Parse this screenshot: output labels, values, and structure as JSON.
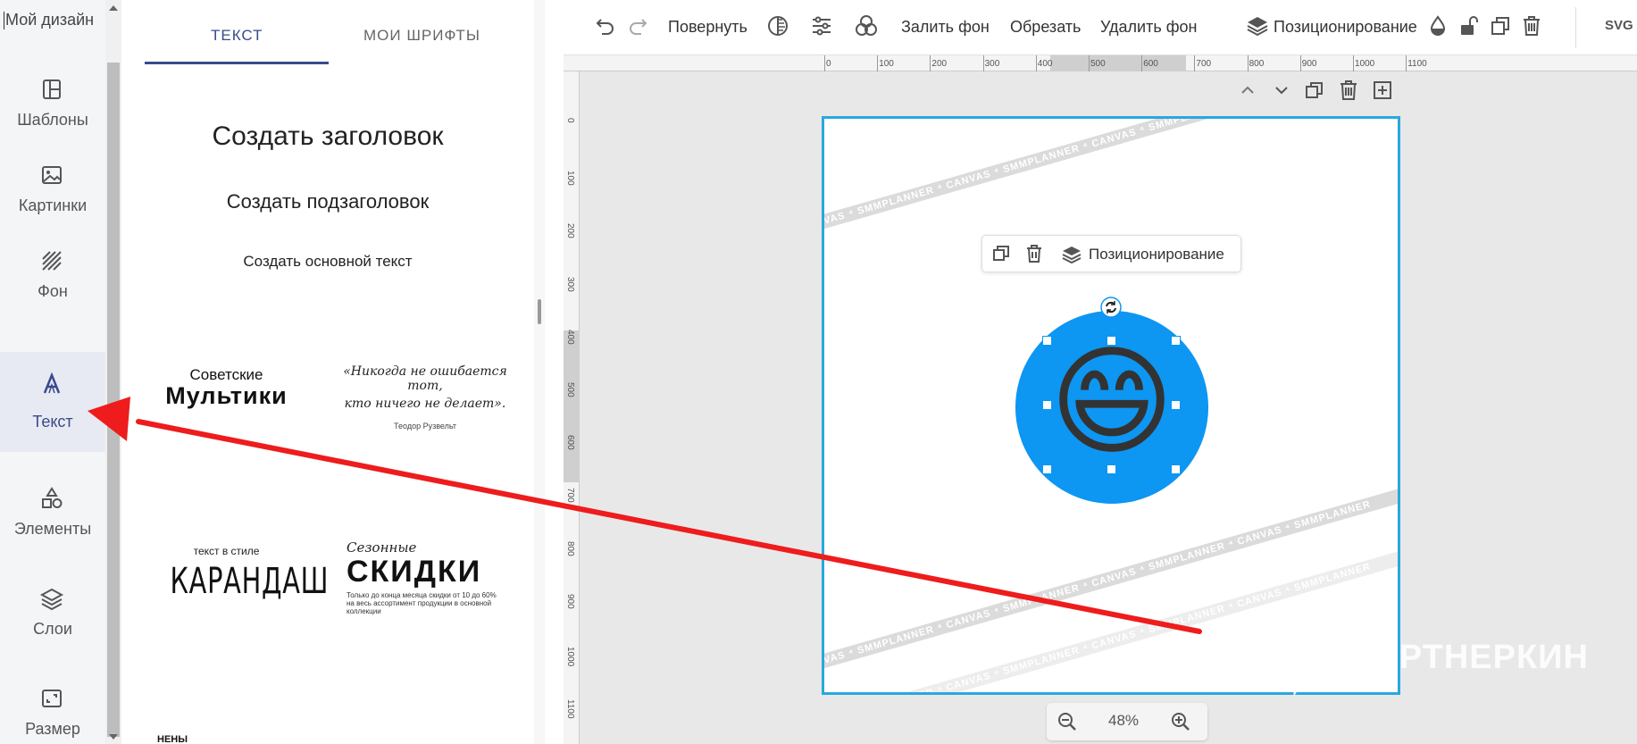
{
  "rail": {
    "title": "Мой дизайн",
    "items": [
      {
        "label": "Шаблоны",
        "icon": "templates-icon"
      },
      {
        "label": "Картинки",
        "icon": "image-icon"
      },
      {
        "label": "Фон",
        "icon": "background-icon"
      },
      {
        "label": "Текст",
        "icon": "text-icon",
        "active": true
      },
      {
        "label": "Элементы",
        "icon": "elements-icon"
      },
      {
        "label": "Слои",
        "icon": "layers-icon"
      },
      {
        "label": "Размер",
        "icon": "resize-icon"
      }
    ]
  },
  "panel": {
    "tabs": [
      {
        "label": "ТЕКСТ",
        "active": true
      },
      {
        "label": "МОИ ШРИФТЫ",
        "active": false
      }
    ],
    "add_heading": "Создать заголовок",
    "add_subheading": "Создать подзаголовок",
    "add_body": "Создать основной текст",
    "templates": [
      {
        "line1": "Советские",
        "line2": "Мультики"
      },
      {
        "line1": "«Никогда не ошибается тот,",
        "line2": "кто ничего не делает».",
        "line3": "Теодор Рузвельт"
      },
      {
        "line1": "текст в стиле",
        "line2": "КАРАНДАШ"
      },
      {
        "line1": "Сезонные",
        "line2": "СКИДКИ",
        "line3": "Только до конца месяца скидки от 10 до 60%",
        "line4": "на весь ассортимент продукции в основной",
        "line5": "коллекции"
      }
    ],
    "more_hint": "НЕНЫ"
  },
  "toolbar": {
    "rotate": "Повернуть",
    "fill_bg": "Залить фон",
    "crop": "Обрезать",
    "remove_bg": "Удалить фон",
    "positioning": "Позиционирование",
    "export": "SVG"
  },
  "ruler": {
    "top": [
      "0",
      "100",
      "200",
      "300",
      "400",
      "500",
      "600",
      "700",
      "800",
      "900",
      "1000",
      "1100"
    ],
    "left": [
      "0",
      "100",
      "200",
      "300",
      "400",
      "500",
      "600",
      "700",
      "800",
      "900",
      "1000",
      "1100"
    ]
  },
  "canvas": {
    "stripe_text": "CANVAS ⁴ SMMPLANNER ⁴ CANVAS ⁴ SMMPLANNER ⁴ CANVAS ⁴ SMMPLANNER ⁴ CANVAS ⁴ SMMPLANNER",
    "context_menu": {
      "positioning": "Позиционирование"
    },
    "element_emoji": "😄",
    "element_bg": "#0d96f2"
  },
  "zoom": {
    "value": "48%"
  },
  "watermark": {
    "text": "ПАРТНЕРКИН"
  },
  "colors": {
    "accent": "#3a4a8a",
    "selection": "#29a8e0",
    "annotation_arrow": "#ee1c1c"
  }
}
